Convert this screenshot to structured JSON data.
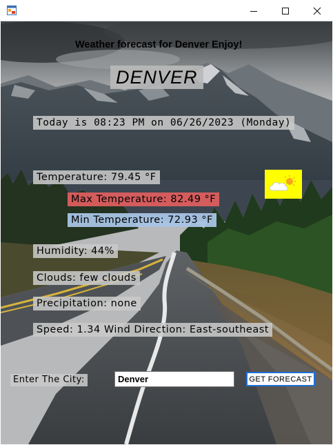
{
  "window": {
    "app_icon": "form-icon",
    "controls": {
      "minimize": "minimize-icon",
      "maximize": "maximize-icon",
      "close": "close-icon"
    }
  },
  "header": {
    "text": "Weather forecast for Denver Enjoy!"
  },
  "city_title": "DENVER",
  "date_line": "Today is 08:23 PM on 06/26/2023 (Monday)",
  "weather": {
    "temperature": "Temperature: 79.45 °F",
    "max_temperature": "Max Temperature: 82.49 °F",
    "min_temperature": "Min Temperature: 72.93 °F",
    "humidity": "Humidity: 44%",
    "clouds": "Clouds: few clouds",
    "precipitation": "Precipitation: none",
    "wind": "Speed: 1.34 Wind Direction: East-southeast",
    "icon": "partly-cloudy-icon"
  },
  "form": {
    "city_label": "Enter The City:",
    "city_value": "Denver",
    "button_label": "GET FORECAST"
  },
  "colors": {
    "max_bg": "#dc5e5e",
    "min_bg": "#a8c4e4",
    "icon_bg": "#ffff00",
    "button_border": "#1e6fd9"
  }
}
